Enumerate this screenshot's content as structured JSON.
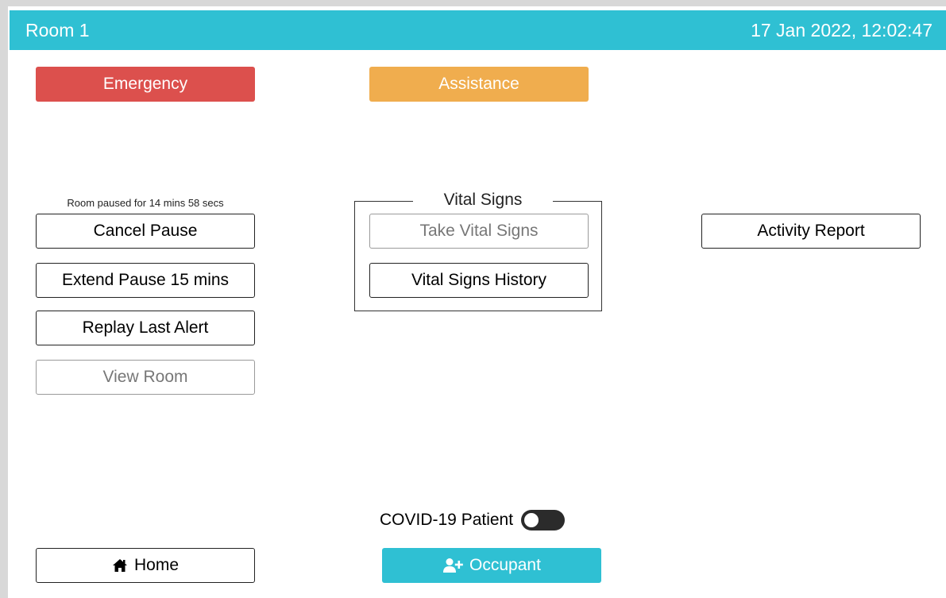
{
  "header": {
    "title": "Room 1",
    "datetime": "17 Jan 2022, 12:02:47",
    "color": "#2fc0d3"
  },
  "alerts": {
    "emergency_label": "Emergency",
    "emergency_color": "#dc504d",
    "assistance_label": "Assistance",
    "assistance_color": "#f0ad4e"
  },
  "pause": {
    "status_text": "Room paused for 14 mins 58 secs",
    "cancel_label": "Cancel Pause",
    "extend_label": "Extend Pause 15 mins",
    "replay_label": "Replay Last Alert",
    "view_room_label": "View Room",
    "view_room_disabled": true
  },
  "vital_signs": {
    "section_title": "Vital Signs",
    "take_label": "Take Vital Signs",
    "take_disabled": true,
    "history_label": "Vital Signs History"
  },
  "activity": {
    "report_label": "Activity Report"
  },
  "covid": {
    "label": "COVID-19 Patient",
    "enabled": false
  },
  "footer": {
    "home_label": "Home",
    "home_icon": "home-icon",
    "occupant_label": "Occupant",
    "occupant_icon": "add-user-icon",
    "occupant_color": "#2fc0d3"
  }
}
